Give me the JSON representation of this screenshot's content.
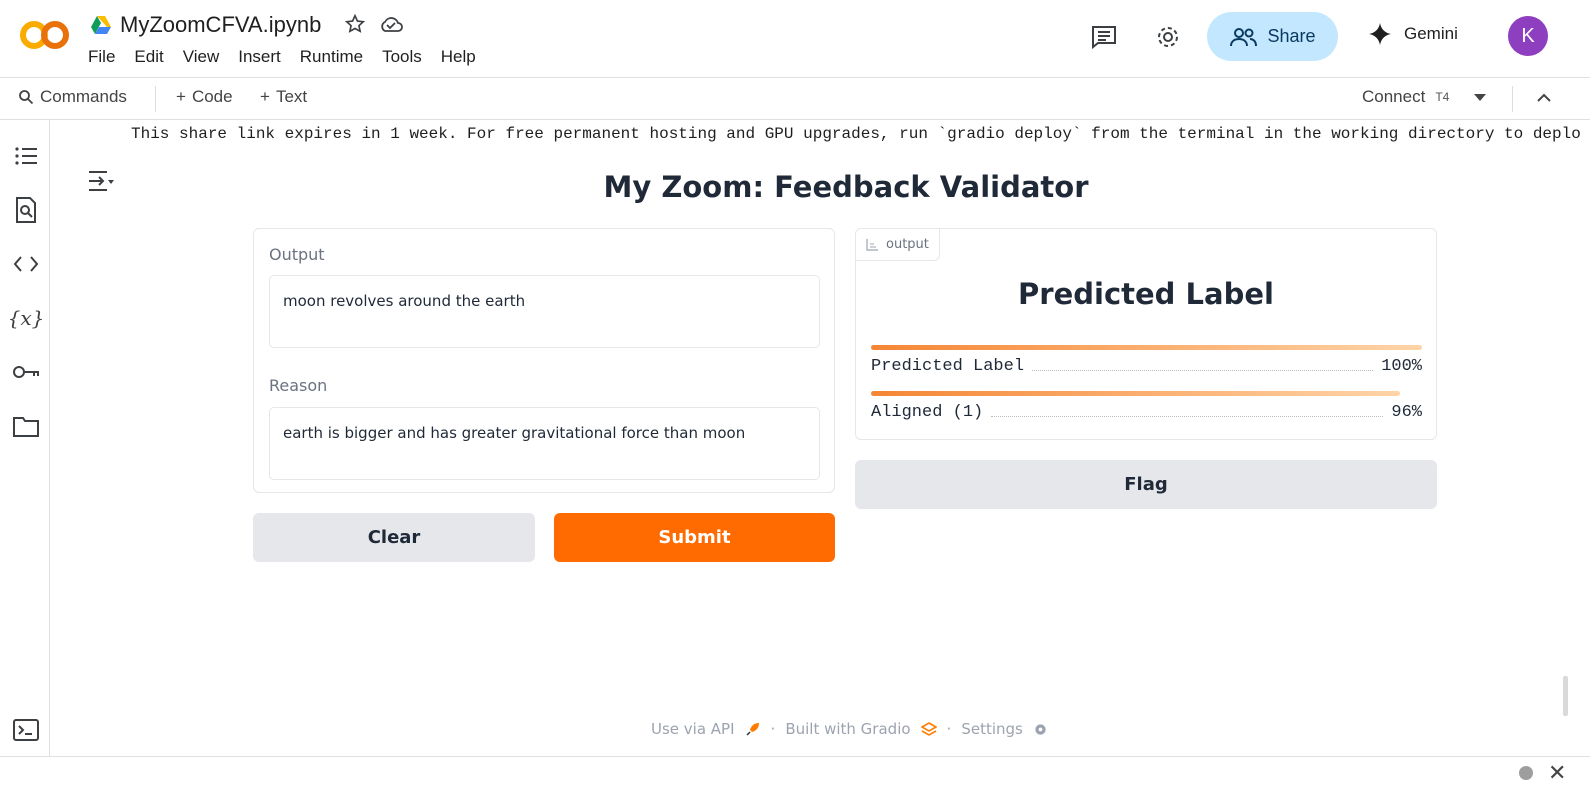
{
  "header": {
    "notebook_title": "MyZoomCFVA.ipynb",
    "menu": [
      "File",
      "Edit",
      "View",
      "Insert",
      "Runtime",
      "Tools",
      "Help"
    ],
    "share_label": "Share",
    "gemini_label": "Gemini",
    "avatar_initial": "K"
  },
  "toolbar": {
    "commands_label": "Commands",
    "code_label": "Code",
    "text_label": "Text",
    "connect_label": "Connect",
    "gpu_label": "T4"
  },
  "output": {
    "share_message": "This share link expires in 1 week. For free permanent hosting and GPU upgrades, run `gradio deploy` from the terminal in the working directory to deplo"
  },
  "app": {
    "title": "My Zoom: Feedback Validator",
    "fields": [
      {
        "label": "Output",
        "value": "moon revolves around the earth"
      },
      {
        "label": "Reason",
        "value": "earth is bigger and has greater  gravitational force than moon"
      }
    ],
    "clear_label": "Clear",
    "submit_label": "Submit",
    "flag_label": "Flag",
    "output_tag": "output",
    "predicted_title": "Predicted Label",
    "confidences": [
      {
        "label": "Predicted Label",
        "value_text": "100%",
        "fraction": 1.0
      },
      {
        "label": "Aligned (1)",
        "value_text": "96%",
        "fraction": 0.96
      }
    ]
  },
  "footer": {
    "api_label": "Use via API",
    "built_label": "Built with Gradio",
    "settings_label": "Settings",
    "separator": "·"
  },
  "colors": {
    "accent": "#ff6b00",
    "share_bg": "#c2e7ff",
    "avatar_bg": "#8e3fbf"
  }
}
